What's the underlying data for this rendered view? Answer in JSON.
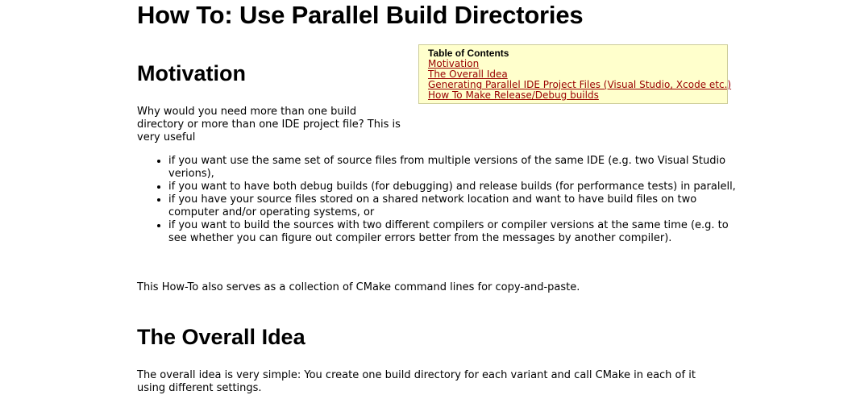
{
  "page": {
    "title": "How To: Use Parallel Build Directories"
  },
  "toc": {
    "title": "Table of Contents",
    "links": [
      "Motivation",
      "The Overall Idea",
      "Generating Parallel IDE Project Files (Visual Studio, Xcode etc.)",
      "How To Make Release/Debug builds"
    ]
  },
  "motivation": {
    "heading": "Motivation",
    "intro": "Why would you need more than one build directory or more than one IDE project file? This is very useful",
    "bullets": [
      "if you want use the same set of source files from multiple versions of the same IDE (e.g. two Visual Studio verions),",
      "if you want to have both debug builds (for debugging) and release builds (for performance tests) in paralell,",
      "if you have your source files stored on a shared network location and want to have build files on two computer and/or operating systems, or",
      "if you want to build the sources with two different compilers or compiler versions at the same time (e.g. to see whether you can figure out compiler errors better from the messages by another compiler)."
    ],
    "outro": "This How-To also serves as a collection of CMake command lines for copy-and-paste."
  },
  "overall_idea": {
    "heading": "The Overall Idea",
    "text": "The overall idea is very simple: You create one build directory for each variant and call CMake in each of it using different settings."
  },
  "colors": {
    "link": "#990000",
    "toc_background": "#ffffcc",
    "toc_border": "#cccc99"
  }
}
